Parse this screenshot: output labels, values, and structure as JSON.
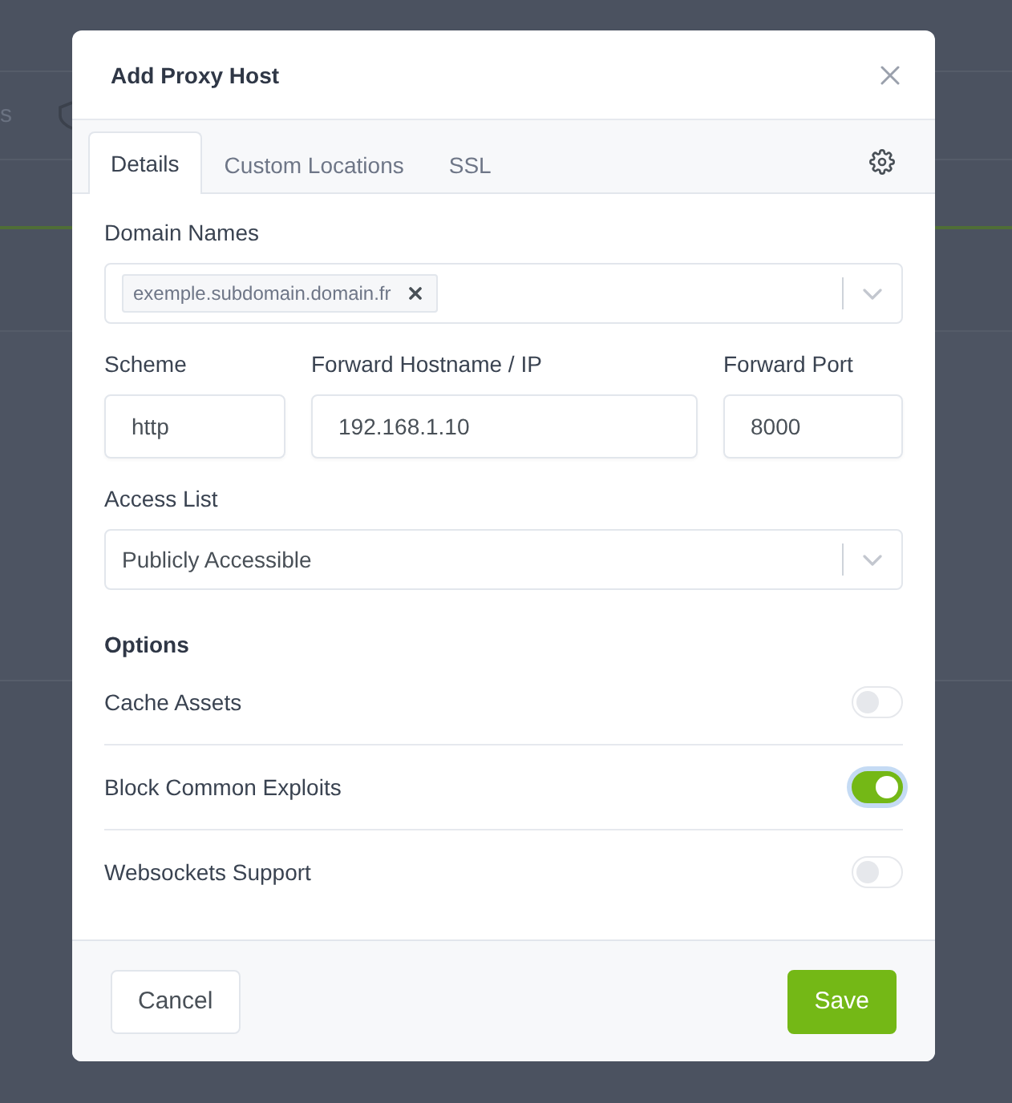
{
  "background": {
    "nav_text": "s"
  },
  "dialog": {
    "title": "Add Proxy Host",
    "tabs": [
      {
        "label": "Details",
        "selected": true
      },
      {
        "label": "Custom Locations",
        "selected": false
      },
      {
        "label": "SSL",
        "selected": false
      }
    ],
    "domain_names": {
      "label": "Domain Names",
      "tags": [
        "exemple.subdomain.domain.fr"
      ]
    },
    "forward_fields": [
      {
        "label": "Scheme",
        "value": "http"
      },
      {
        "label": "Forward Hostname / IP",
        "value": "192.168.1.10"
      },
      {
        "label": "Forward Port",
        "value": "8000"
      }
    ],
    "access_list": {
      "label": "Access List",
      "value": "Publicly Accessible"
    },
    "options": {
      "heading": "Options",
      "items": [
        {
          "label": "Cache Assets",
          "on": false,
          "focused": false
        },
        {
          "label": "Block Common Exploits",
          "on": true,
          "focused": true
        },
        {
          "label": "Websockets Support",
          "on": false,
          "focused": false
        }
      ]
    },
    "buttons": [
      {
        "label": "Cancel",
        "kind": "secondary"
      },
      {
        "label": "Save",
        "kind": "primary"
      }
    ]
  }
}
